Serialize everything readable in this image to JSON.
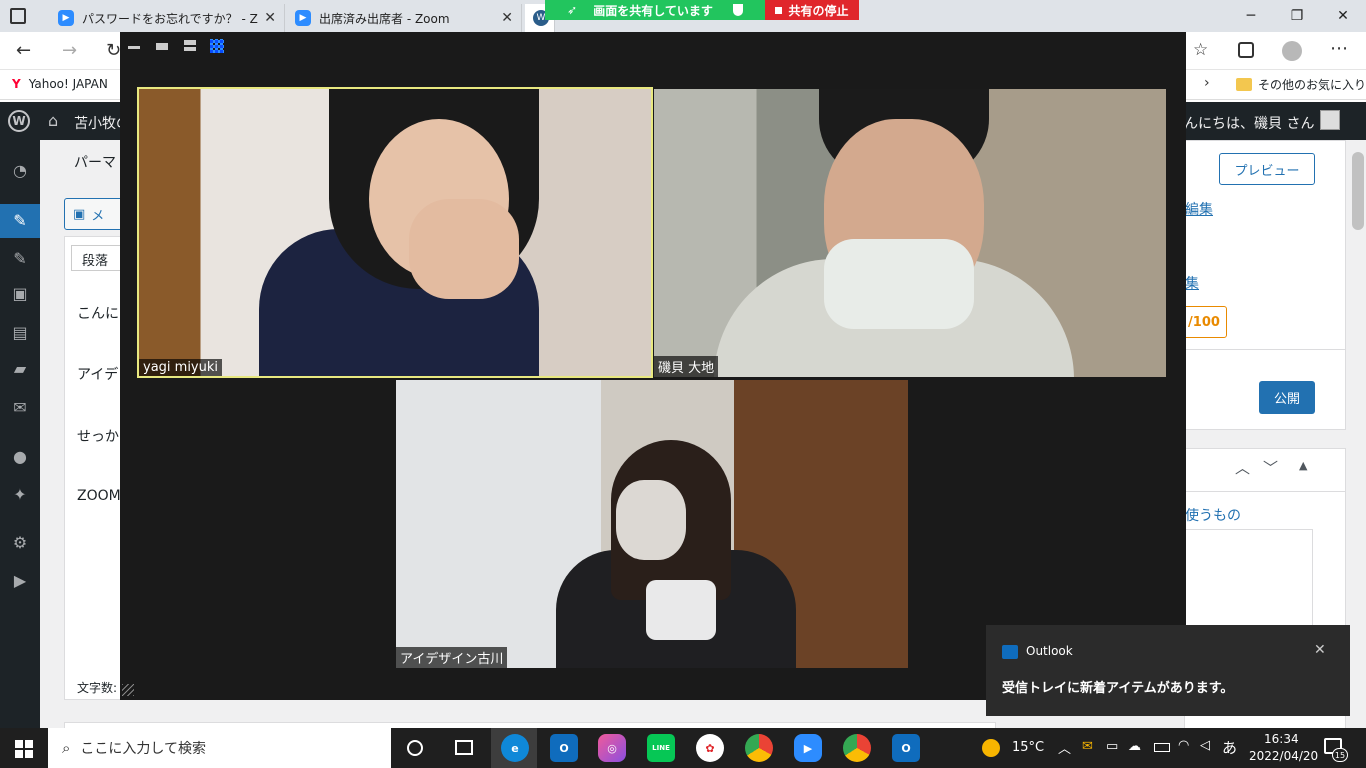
{
  "browser": {
    "tabs": [
      {
        "label": "パスワードをお忘れですか？ - Zoom",
        "close": "✕"
      },
      {
        "label": "出席済み出席者 - Zoom",
        "close": "✕"
      },
      {
        "label": "W"
      }
    ],
    "favorites": {
      "yahoo": "Yahoo! JAPAN",
      "other": "その他のお気に入り"
    }
  },
  "share": {
    "sharing_label": "画面を共有しています",
    "stop_label": "共有の停止"
  },
  "wordpress": {
    "site_name": "苫小牧の",
    "greeting": "んにちは、磯貝 さん",
    "left_texts": {
      "permalink": "パーマ",
      "media": "メ",
      "block_type": "段落",
      "line1": "こんに",
      "line2": "アイデ",
      "line3": "せっか",
      "line4": "ZOOM",
      "wordcount": "文字数:"
    },
    "right": {
      "preview": "プレビュー",
      "edit": "編集",
      "edit2": "集",
      "score": "/100",
      "publish": "公開",
      "use": "使うもの"
    }
  },
  "zoom": {
    "participants": [
      {
        "name": "yagi miyuki",
        "active": true
      },
      {
        "name": "磯貝 大地",
        "active": false
      },
      {
        "name": "アイデザイン古川",
        "active": false
      }
    ]
  },
  "toast": {
    "app": "Outlook",
    "message": "受信トレイに新着アイテムがあります。",
    "close": "✕"
  },
  "taskbar": {
    "search_placeholder": "ここに入力して検索",
    "weather": "15°C",
    "ime": "あ",
    "time": "16:34",
    "date": "2022/04/20",
    "notifications": "15",
    "line_label": "LINE"
  },
  "colors": {
    "accent": "#2271b1",
    "zoom_blue": "#2d8cff",
    "active_speaker": "#e8e880",
    "share_green": "#22c55e",
    "stop_red": "#e0262b",
    "score_orange": "#e98a00"
  }
}
